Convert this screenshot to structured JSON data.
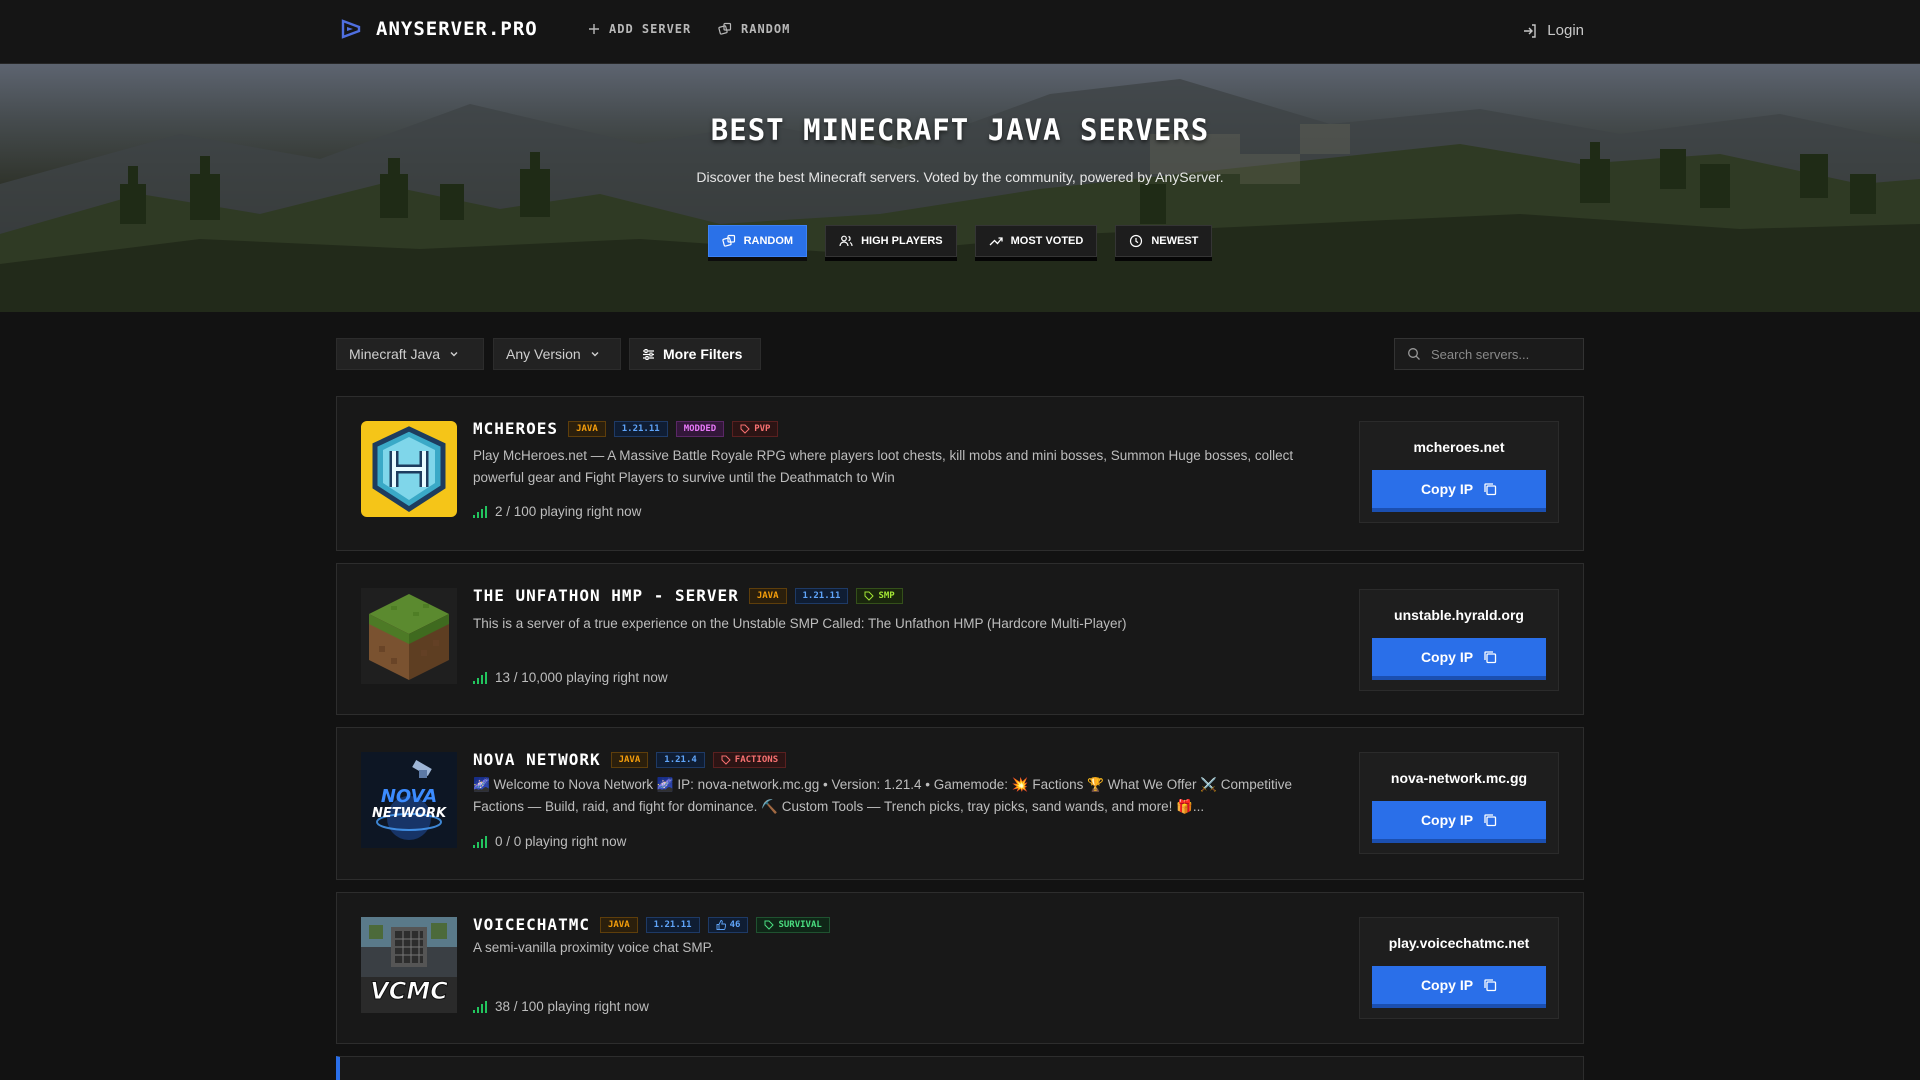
{
  "nav": {
    "logo_text": "ANYSERVER.PRO",
    "add_server": "ADD SERVER",
    "random": "RANDOM",
    "login": "Login"
  },
  "hero": {
    "title": "BEST MINECRAFT JAVA SERVERS",
    "subtitle": "Discover the best Minecraft servers. Voted by the community, powered by AnyServer.",
    "sort_buttons": [
      {
        "label": "RANDOM",
        "icon": "dice-icon",
        "active": true
      },
      {
        "label": "HIGH PLAYERS",
        "icon": "users-icon",
        "active": false
      },
      {
        "label": "MOST VOTED",
        "icon": "trending-up-icon",
        "active": false
      },
      {
        "label": "NEWEST",
        "icon": "clock-icon",
        "active": false
      }
    ]
  },
  "filters": {
    "edition": "Minecraft Java",
    "version": "Any Version",
    "more": "More Filters",
    "search_placeholder": "Search servers..."
  },
  "servers": [
    {
      "name": "MCHEROES",
      "badges": [
        "JAVA",
        "1.21.11",
        "MODDED",
        "PVP"
      ],
      "description": "Play McHeroes.net — A Massive Battle Royale RPG where players loot chests, kill mobs and mini bosses, Summon Huge bosses, collect powerful gear and Fight Players to survive until the Deathmatch to Win",
      "players": "2 / 100 playing right now",
      "ip": "mcheroes.net",
      "copy_label": "Copy IP"
    },
    {
      "name": "THE UNFATHON HMP - SERVER",
      "badges": [
        "JAVA",
        "1.21.11",
        "SMP"
      ],
      "description": "This is a server of a true experience on the Unstable SMP Called: The Unfathon HMP (Hardcore Multi-Player)",
      "players": "13 / 10,000 playing right now",
      "ip": "unstable.hyrald.org",
      "copy_label": "Copy IP"
    },
    {
      "name": "NOVA NETWORK",
      "badges": [
        "JAVA",
        "1.21.4",
        "FACTIONS"
      ],
      "description": "🌌 Welcome to Nova Network 🌌 IP: nova-network.mc.gg • Version: 1.21.4 • Gamemode: 💥 Factions 🏆 What We Offer ⚔️ Competitive Factions — Build, raid, and fight for dominance. ⛏️ Custom Tools — Trench picks, tray picks, sand wands, and more! 🎁...",
      "players": "0 / 0 playing right now",
      "ip": "nova-network.mc.gg",
      "copy_label": "Copy IP",
      "logo_text": [
        "NOVA",
        "NETWORK"
      ]
    },
    {
      "name": "VOICECHATMC",
      "badges": [
        "JAVA",
        "1.21.11",
        "46",
        "SURVIVAL"
      ],
      "description": "A semi-vanilla proximity voice chat SMP.",
      "players": "38 / 100 playing right now",
      "ip": "play.voicechatmc.net",
      "copy_label": "Copy IP",
      "logo_text": "VCMC"
    }
  ],
  "colors": {
    "accent": "#2a6fe9",
    "background": "#121212",
    "card": "#181818"
  }
}
